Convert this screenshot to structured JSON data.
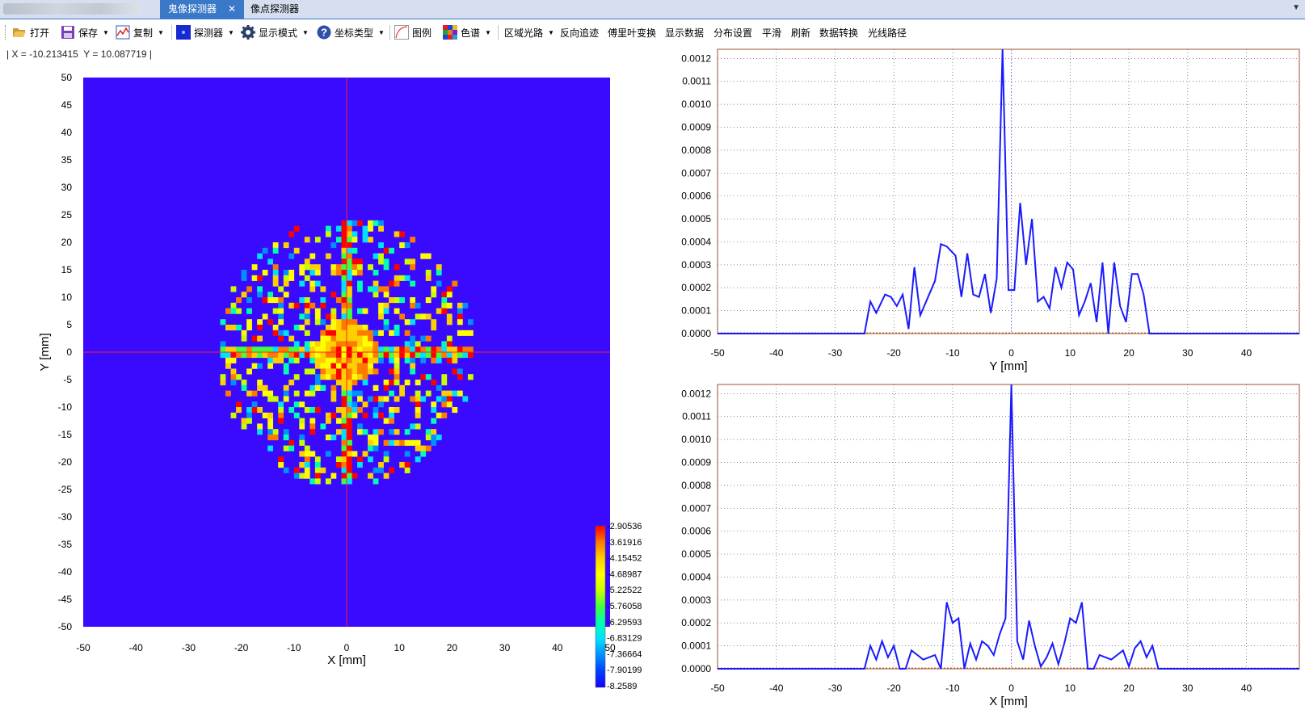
{
  "tabs": [
    {
      "label": "鬼像探测器",
      "active": true
    },
    {
      "label": "像点探测器",
      "active": false
    }
  ],
  "toolbar": {
    "open": "打开",
    "save": "保存",
    "copy": "复制",
    "detector": "探测器",
    "display_mode": "显示模式",
    "coord_type": "坐标类型",
    "legend": "图例",
    "color_spectrum": "色谱",
    "region_path": "区域光路",
    "reverse_trace": "反向追迹",
    "fourier": "傅里叶变换",
    "show_data": "显示数据",
    "distribution": "分布设置",
    "smooth": "平滑",
    "refresh": "刷新",
    "data_convert": "数据转换",
    "ray_path": "光线路径"
  },
  "coords_readout": "| X = -10.213415  Y = 10.087719 |",
  "chart_data": [
    {
      "type": "heatmap",
      "xlabel": "X [mm]",
      "ylabel": "Y [mm]",
      "xlim": [
        -50,
        50
      ],
      "ylim": [
        -50,
        50
      ],
      "xticks": [
        -50,
        -40,
        -30,
        -20,
        -10,
        0,
        10,
        20,
        30,
        40,
        50
      ],
      "yticks": [
        50,
        45,
        40,
        35,
        30,
        25,
        20,
        15,
        10,
        5,
        0,
        -5,
        -10,
        -15,
        -20,
        -25,
        -30,
        -35,
        -40,
        -45,
        -50
      ],
      "grid": 100,
      "spot_radius": 24.5,
      "crosshair": {
        "x": 0,
        "y": 0,
        "color": "#ff2020"
      },
      "colorbar": {
        "labels": [
          "-2.90536",
          "-3.61916",
          "-4.15452",
          "-4.68987",
          "-5.22522",
          "-5.76058",
          "-6.29593",
          "-6.83129",
          "-7.36664",
          "-7.90199",
          "-8.2589"
        ],
        "colors": [
          "#ff0000",
          "#ff7a00",
          "#ffd000",
          "#ffff00",
          "#c8ff00",
          "#40ff40",
          "#00ffb0",
          "#00e0ff",
          "#0090ff",
          "#0040ff",
          "#1a00ff"
        ]
      },
      "background_color": "#3a0aff"
    },
    {
      "type": "line",
      "xlabel": "Y [mm]",
      "xlim": [
        -50,
        49
      ],
      "ylim": [
        0,
        0.00124
      ],
      "grid": true,
      "line_color": "#1a1aff",
      "xticks": [
        -50,
        -40,
        -30,
        -20,
        -10,
        0,
        10,
        20,
        30,
        40
      ],
      "yticks": [
        "0.0000",
        "0.0001",
        "0.0002",
        "0.0003",
        "0.0004",
        "0.0005",
        "0.0006",
        "0.0007",
        "0.0008",
        "0.0009",
        "0.0010",
        "0.0011",
        "0.0012"
      ],
      "x": [
        -50,
        -25,
        -24,
        -23,
        -21.5,
        -20.5,
        -19.5,
        -18.5,
        -17.5,
        -16.5,
        -15.5,
        -13,
        -12,
        -11,
        -9.5,
        -8.5,
        -7.5,
        -6.5,
        -5.5,
        -4.5,
        -3.5,
        -2.5,
        -1.5,
        -0.5,
        0,
        0.5,
        1.5,
        2.5,
        3.5,
        4.5,
        5.5,
        6.5,
        7.5,
        8.5,
        9.5,
        10.5,
        11.5,
        12.5,
        13.5,
        14.5,
        15.5,
        16.5,
        17.5,
        18.5,
        19.5,
        20.5,
        21.5,
        22.5,
        23.5,
        24.5,
        49
      ],
      "y": [
        0,
        0,
        0.00014,
        9e-05,
        0.00017,
        0.00016,
        0.00012,
        0.00017,
        2e-05,
        0.00029,
        8e-05,
        0.00023,
        0.00039,
        0.00038,
        0.00034,
        0.00016,
        0.00035,
        0.00017,
        0.00016,
        0.00026,
        9e-05,
        0.00024,
        0.00124,
        0.00019,
        0.00019,
        0.00019,
        0.00057,
        0.0003,
        0.0005,
        0.00014,
        0.00016,
        0.00011,
        0.00029,
        0.0002,
        0.00031,
        0.00028,
        8e-05,
        0.00014,
        0.00022,
        5e-05,
        0.00031,
        0,
        0.00031,
        0.00012,
        5e-05,
        0.00026,
        0.00026,
        0.00017,
        0,
        0,
        0
      ]
    },
    {
      "type": "line",
      "xlabel": "X [mm]",
      "xlim": [
        -50,
        49
      ],
      "ylim": [
        0,
        0.00124
      ],
      "grid": true,
      "line_color": "#1a1aff",
      "xticks": [
        -50,
        -40,
        -30,
        -20,
        -10,
        0,
        10,
        20,
        30,
        40
      ],
      "yticks": [
        "0.0000",
        "0.0001",
        "0.0002",
        "0.0003",
        "0.0004",
        "0.0005",
        "0.0006",
        "0.0007",
        "0.0008",
        "0.0009",
        "0.0010",
        "0.0011",
        "0.0012"
      ],
      "x": [
        -50,
        -25,
        -24,
        -23,
        -22,
        -21,
        -20,
        -19,
        -18,
        -17,
        -16,
        -15,
        -14,
        -13,
        -12,
        -11,
        -10,
        -9,
        -8,
        -7,
        -6,
        -5,
        -4,
        -3,
        -2,
        -1,
        0,
        1,
        2,
        3,
        4,
        5,
        6,
        7,
        8,
        9,
        10,
        11,
        12,
        13,
        14,
        15,
        16,
        17,
        18,
        19,
        20,
        21,
        22,
        23,
        24,
        25,
        49
      ],
      "y": [
        0,
        0,
        0.0001,
        4e-05,
        0.00012,
        5e-05,
        0.0001,
        0,
        0,
        8e-05,
        6e-05,
        4e-05,
        5e-05,
        6e-05,
        0,
        0.00029,
        0.0002,
        0.00022,
        0,
        0.00011,
        4e-05,
        0.00012,
        0.0001,
        6e-05,
        0.00015,
        0.00022,
        0.00124,
        0.00012,
        4e-05,
        0.00021,
        0.0001,
        1e-05,
        5e-05,
        0.00011,
        2e-05,
        0.00011,
        0.00022,
        0.0002,
        0.00029,
        0,
        0,
        6e-05,
        5e-05,
        4e-05,
        6e-05,
        8e-05,
        1e-05,
        9e-05,
        0.00012,
        5e-05,
        0.0001,
        0,
        0
      ]
    }
  ]
}
